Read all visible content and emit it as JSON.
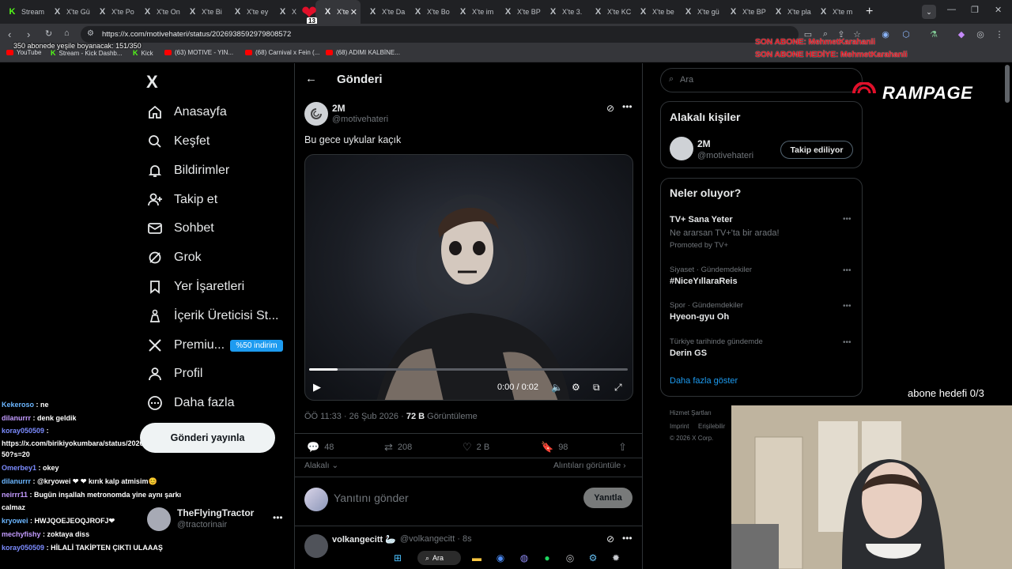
{
  "browser": {
    "tabs": [
      {
        "label": "Stream",
        "icon": "kick"
      },
      {
        "label": "X'te Gü",
        "icon": "x"
      },
      {
        "label": "X'te Po",
        "icon": "x"
      },
      {
        "label": "X'te On",
        "icon": "x"
      },
      {
        "label": "X'te Bi",
        "icon": "x"
      },
      {
        "label": "X'te ey",
        "icon": "x"
      },
      {
        "label": "X",
        "icon": "x"
      },
      {
        "label": "X'te",
        "icon": "x",
        "active": true
      },
      {
        "label": "X'te Da",
        "icon": "x"
      },
      {
        "label": "X'te Bo",
        "icon": "x"
      },
      {
        "label": "X'te im",
        "icon": "x"
      },
      {
        "label": "X'te BP",
        "icon": "x"
      },
      {
        "label": "X'te 3.",
        "icon": "x"
      },
      {
        "label": "X'te KC",
        "icon": "x"
      },
      {
        "label": "X'te be",
        "icon": "x"
      },
      {
        "label": "X'te gü",
        "icon": "x"
      },
      {
        "label": "X'te BP",
        "icon": "x"
      },
      {
        "label": "X'te pla",
        "icon": "x"
      },
      {
        "label": "X'te m",
        "icon": "x"
      }
    ],
    "url": "https://x.com/motivehateri/status/2026938592979808572",
    "bookmarks": [
      {
        "label": "YouTube",
        "icon": "youtube"
      },
      {
        "label": "Stream - Kick Dashb...",
        "icon": "kick"
      },
      {
        "label": "Kick",
        "icon": "kick"
      },
      {
        "label": "(63) MOTIVE - YIN...",
        "icon": "youtube"
      },
      {
        "label": "(68) Carnival x Fein (...",
        "icon": "youtube"
      },
      {
        "label": "(68) ADIMI KALBİNE...",
        "icon": "youtube"
      }
    ],
    "heart_badge": "13"
  },
  "overlay": {
    "progress_text": "350 abonede yeşile boyanacak: 151/350",
    "sub_line1": "SON ABONE: MehmetKarahanli",
    "sub_line2": "SON ABONE HEDİYE: MehmetKarahanli",
    "goal_text": "abone hedefi 0/3",
    "rampage": "RAMPAGE"
  },
  "nav": {
    "logo": "X",
    "items": [
      {
        "label": "Anasayfa",
        "icon": "home-icon"
      },
      {
        "label": "Keşfet",
        "icon": "search-icon"
      },
      {
        "label": "Bildirimler",
        "icon": "bell-icon"
      },
      {
        "label": "Takip et",
        "icon": "follow-icon"
      },
      {
        "label": "Sohbet",
        "icon": "mail-icon"
      },
      {
        "label": "Grok",
        "icon": "grok-icon"
      },
      {
        "label": "Yer İşaretleri",
        "icon": "bookmark-icon"
      },
      {
        "label": "İçerik Üreticisi St...",
        "icon": "creator-icon"
      },
      {
        "label": "Premiu...",
        "icon": "x-icon"
      },
      {
        "label": "Profil",
        "icon": "profile-icon"
      },
      {
        "label": "Daha fazla",
        "icon": "more-icon"
      }
    ],
    "premium_badge": "%50 indirim",
    "post_button": "Gönderi yayınla"
  },
  "account": {
    "name": "TheFlyingTractor",
    "handle": "@tractorinair"
  },
  "chat": [
    {
      "user": "Kekeroso",
      "text": ": ne"
    },
    {
      "user": "dilanurrr",
      "text": ": denk geldik"
    },
    {
      "user": "koray050509",
      "text": ":"
    },
    {
      "user": "",
      "text": "https://x.com/birikiyokumbara/status/202693619752219880"
    },
    {
      "user": "",
      "text": "50?s=20"
    },
    {
      "user": "Omerbey1",
      "text": ": okey"
    },
    {
      "user": "dilanurrr",
      "text": ": @kryowei ❤ ❤ kırık kalp atmisim😊"
    },
    {
      "user": "neirrr11",
      "text": ": Bugün inşallah metronomda yine aynı şarkı"
    },
    {
      "user": "",
      "text": "calmaz"
    },
    {
      "user": "kryowei",
      "text": ": HWJQOEJEOQJROFJ❤"
    },
    {
      "user": "mechyfishy",
      "text": ": zoktaya diss"
    },
    {
      "user": "koray050509",
      "text": ": HİLALİ TAKİPTEN ÇIKTI ULAAAŞ"
    }
  ],
  "main": {
    "title": "Gönderi",
    "author_name": "2M",
    "author_handle": "@motivehateri",
    "post_text": "Bu gece uykular kaçık",
    "video_time": "0:00 / 0:02",
    "video_progress": 0.09,
    "meta_time": "ÖÖ 11:33 · 26 Şub 2026 · ",
    "meta_views": "72 B",
    "meta_views_label": " Görüntüleme",
    "replies": "48",
    "reposts": "208",
    "likes": "2 B",
    "bookmarks": "98",
    "relevant": "Alakalı ⌄",
    "quotes": "Alıntıları görüntüle ›",
    "reply_placeholder": "Yanıtını gönder",
    "reply_button": "Yanıtla",
    "next_name": "volkangecitt 🦢",
    "next_handle": "@volkangecitt · 8s"
  },
  "right": {
    "search_placeholder": "Ara",
    "related_title": "Alakalı kişiler",
    "related_name": "2M",
    "related_handle": "@motivehateri",
    "follow_label": "Takip ediliyor",
    "trends_title": "Neler oluyor?",
    "trends": [
      {
        "meta": "",
        "name": "TV+ Sana Yeter",
        "sub": "Ne ararsan TV+'ta bir arada!",
        "promo": "Promoted by TV+"
      },
      {
        "meta": "Siyaset · Gündemdekiler",
        "name": "#NiceYıllaraReis"
      },
      {
        "meta": "Spor · Gündemdekiler",
        "name": "Hyeon-gyu Oh"
      },
      {
        "meta": "Türkiye tarihinde gündemde",
        "name": "Derin GS"
      }
    ],
    "show_more": "Daha fazla göster",
    "footer": [
      "Hizmet Şartları",
      "Imprint",
      "Erişilebilir",
      "© 2026 X Corp."
    ]
  },
  "taskbar": {
    "search": "Ara"
  }
}
